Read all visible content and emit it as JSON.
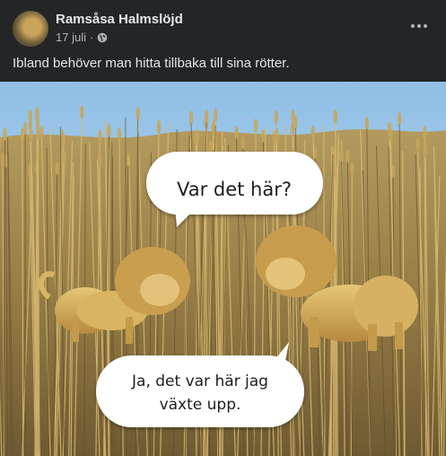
{
  "post": {
    "author": "Ramsåsa Halmslöjd",
    "date": "17 juli",
    "separator": "·",
    "privacy_icon": "globe-icon",
    "more_icon": "more-options-icon",
    "caption": "Ibland behöver man hitta tillbaka till sina rötter."
  },
  "photo": {
    "bubble_top": "Var det här?",
    "bubble_bottom_line1": "Ja, det var här jag",
    "bubble_bottom_line2": "växte upp."
  },
  "colors": {
    "background": "#242526",
    "sky": "#9cc6e6",
    "wheat": "#c9a24e",
    "text_secondary": "#b0b3b8"
  }
}
